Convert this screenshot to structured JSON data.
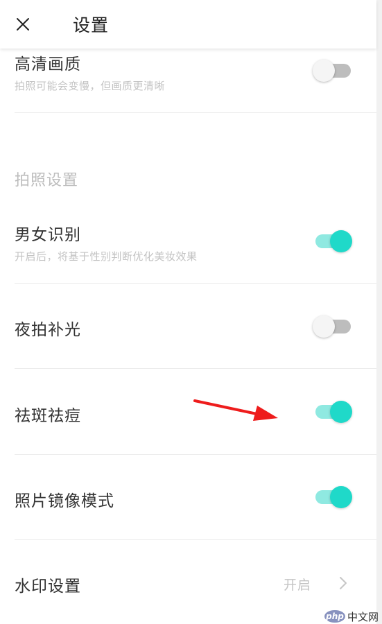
{
  "header": {
    "title": "设置",
    "close_icon": "close-icon"
  },
  "settings": {
    "hd_quality": {
      "title": "高清画质",
      "subtitle": "拍照可能会变慢，但画质更清晰",
      "enabled": false
    },
    "section_photo": "拍照设置",
    "gender_detect": {
      "title": "男女识别",
      "subtitle": "开启后，将基于性别判断优化美妆效果",
      "enabled": true
    },
    "night_fill_light": {
      "title": "夜拍补光",
      "enabled": false
    },
    "blemish_removal": {
      "title": "祛斑祛痘",
      "enabled": true
    },
    "mirror_mode": {
      "title": "照片镜像模式",
      "enabled": true
    },
    "watermark": {
      "title": "水印设置",
      "value": "开启"
    }
  },
  "colors": {
    "toggle_on_knob": "#1fd9c9",
    "toggle_on_track": "#8fe9e1",
    "toggle_off_knob": "#f5f5f5",
    "toggle_off_track": "#bdbdbd",
    "annotation_arrow": "#ee1c1c"
  },
  "watermark_overlay": {
    "badge": "php",
    "text": "中文网"
  }
}
